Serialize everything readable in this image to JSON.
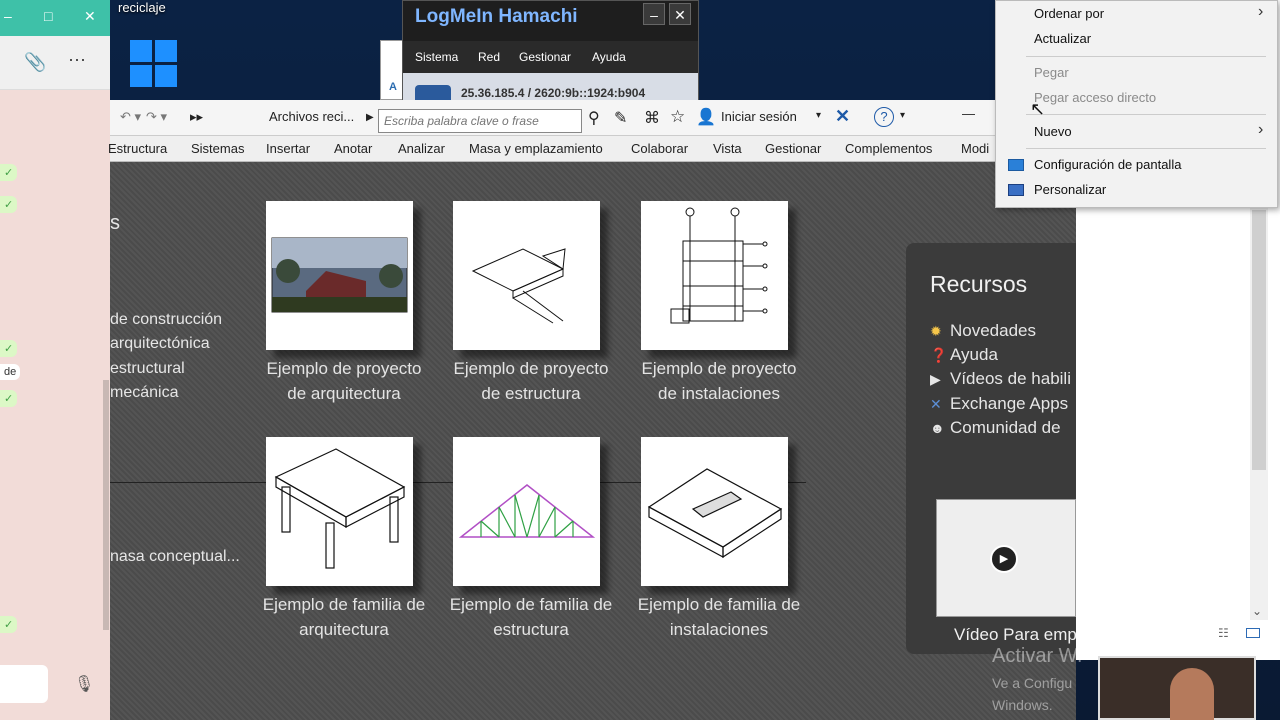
{
  "desktop": {
    "label": "reciclaje"
  },
  "chat": {
    "win_controls": [
      "–",
      "□",
      "✕"
    ],
    "toolbar_icons": [
      "paperclip-icon",
      "more-icon"
    ],
    "bubbles": [
      "✓",
      "✓",
      "✓",
      "de",
      "✓",
      "✓"
    ],
    "mic_icon": "microphone-icon"
  },
  "hamachi": {
    "title": "LogMeIn Hamachi",
    "min": "–",
    "close": "✕",
    "menu": [
      "Sistema",
      "Red",
      "Gestionar",
      "Ayuda"
    ],
    "address": "25.36.185.4 / 2620:9b::1924:b904"
  },
  "bluewin": {
    "letter": "A"
  },
  "revit": {
    "qat_title": "Archivos reci...",
    "search_placeholder": "Escriba palabra clave o frase",
    "signin": "Iniciar sesión",
    "help": "?",
    "ribbon": [
      "Estructura",
      "Sistemas",
      "Insertar",
      "Anotar",
      "Analizar",
      "Masa y emplazamiento",
      "Colaborar",
      "Vista",
      "Gestionar",
      "Complementos",
      "Modi"
    ],
    "left_heading": "s",
    "left_lines": [
      "de construcción",
      "arquitectónica",
      "estructural",
      "mecánica"
    ],
    "left_bottom": "nasa conceptual...",
    "projects": [
      {
        "l1": "Ejemplo de proyecto",
        "l2": "de arquitectura"
      },
      {
        "l1": "Ejemplo de proyecto",
        "l2": "de estructura"
      },
      {
        "l1": "Ejemplo de proyecto",
        "l2": "de instalaciones"
      }
    ],
    "families": [
      {
        "l1": "Ejemplo de familia de",
        "l2": "arquitectura"
      },
      {
        "l1": "Ejemplo de familia de",
        "l2": "estructura"
      },
      {
        "l1": "Ejemplo de familia de",
        "l2": "instalaciones"
      }
    ]
  },
  "resources": {
    "title": "Recursos",
    "items": [
      "Novedades",
      "Ayuda",
      "Vídeos de habili",
      "Exchange Apps",
      "Comunidad de"
    ],
    "video_caption": "Vídeo Para emp"
  },
  "context_menu": {
    "items": [
      "Ordenar por",
      "Actualizar",
      "Pegar",
      "Pegar acceso directo",
      "Nuevo",
      "Configuración de pantalla",
      "Personalizar"
    ]
  },
  "watermark": {
    "line1": "Activar Wi",
    "line2": "Ve a Configu",
    "line3": "Windows."
  }
}
